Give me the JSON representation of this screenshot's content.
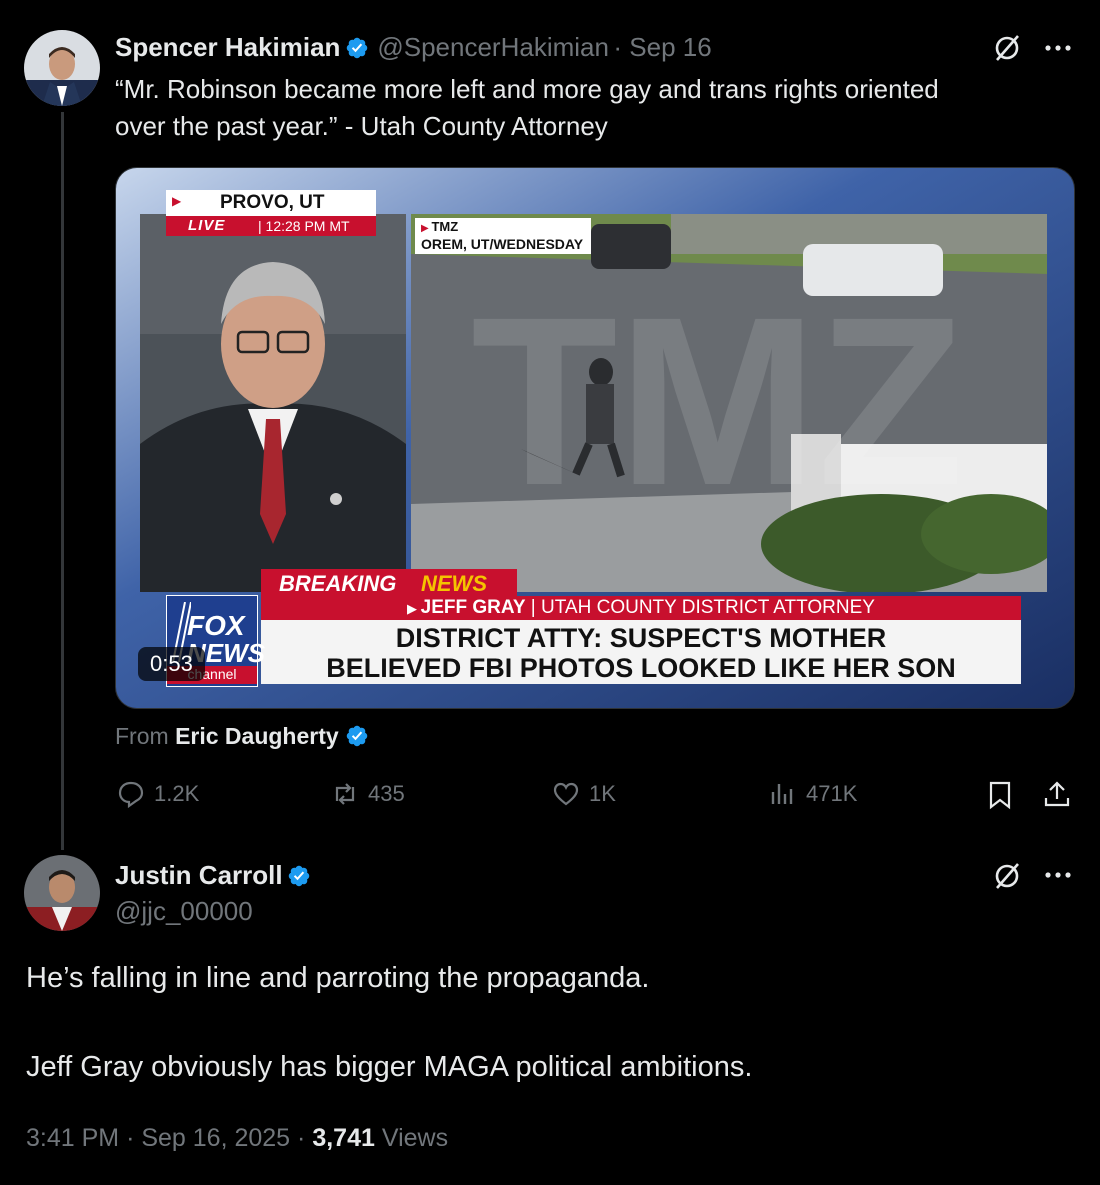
{
  "tweet": {
    "author_name": "Spencer Hakimian",
    "handle": "@SpencerHakimian",
    "date": "Sep 16",
    "text_line1": "“Mr. Robinson became more left and more gay and trans rights oriented",
    "text_line2": "over the past year.” - Utah County Attorney",
    "media": {
      "location": "PROVO, UT",
      "live_label": "LIVE",
      "live_time": "12:28 PM MT",
      "tmz_label": "TMZ",
      "tmz_location": "OREM, UT/WEDNESDAY",
      "breaking": "BREAKING",
      "news": "NEWS",
      "speaker": "JEFF GRAY",
      "speaker_title": "UTAH COUNTY DISTRICT ATTORNEY",
      "headline_line1": "DISTRICT ATTY: SUSPECT'S MOTHER",
      "headline_line2": "BELIEVED FBI PHOTOS LOOKED LIKE HER SON",
      "duration": "0:53",
      "logo_fox": "FOX",
      "logo_news": "NEWS",
      "logo_channel": "channel"
    },
    "from_prefix": "From",
    "from_name": "Eric Daugherty",
    "replies": "1.2K",
    "reposts": "435",
    "likes": "1K",
    "views": "471K"
  },
  "reply": {
    "author_name": "Justin Carroll",
    "handle": "@jjc_00000",
    "text_para1": "He’s falling in line and parroting the propaganda.",
    "text_para2": "Jeff Gray obviously has bigger MAGA political ambitions.",
    "time": "3:41 PM",
    "date": "Sep 16, 2025",
    "views_count": "3,741",
    "views_label": "Views"
  },
  "colors": {
    "verified": "#1d9bf0",
    "muted": "#71767b",
    "fox_red": "#c8102e"
  }
}
